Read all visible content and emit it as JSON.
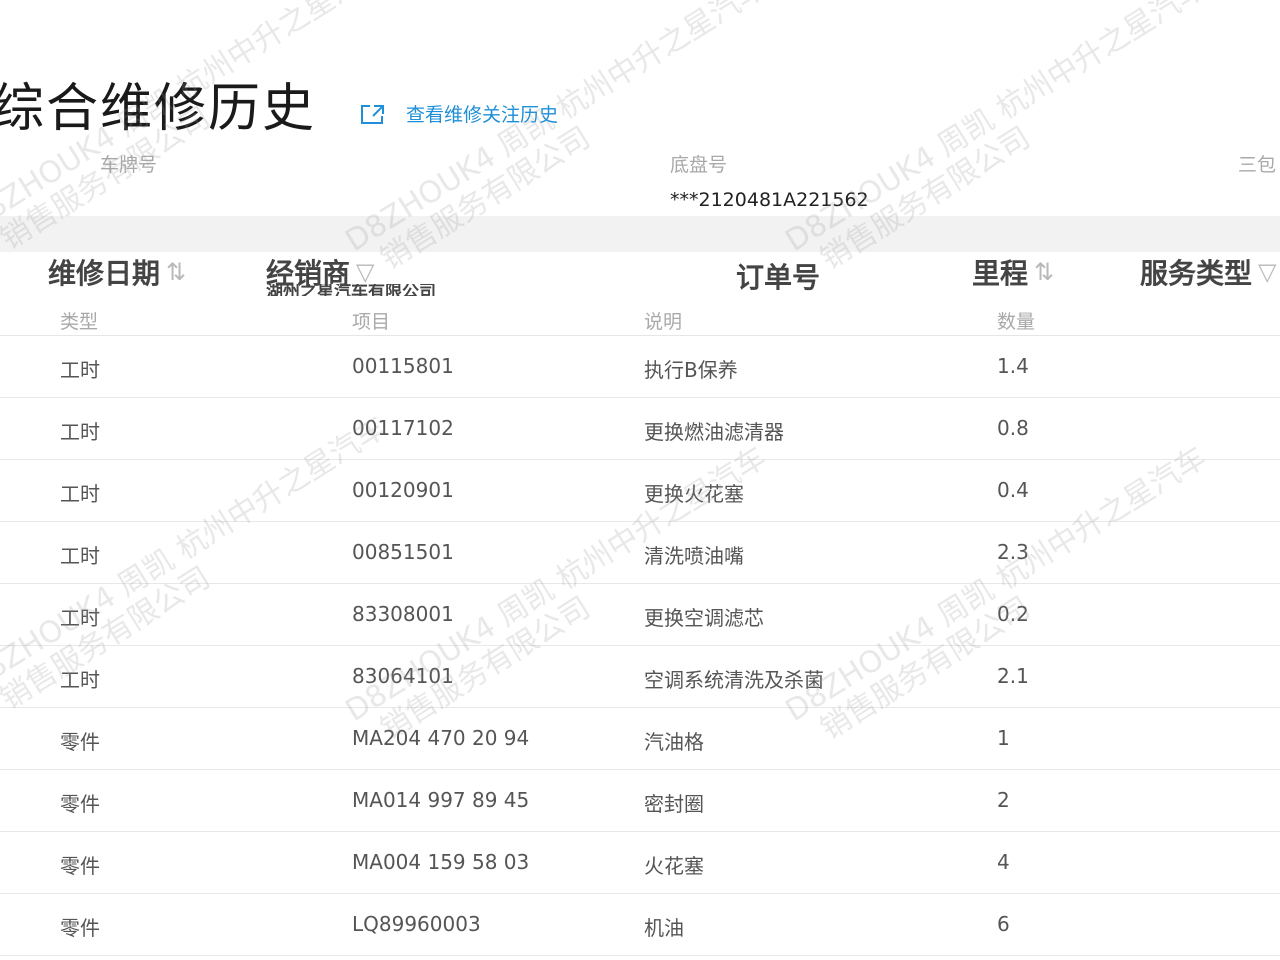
{
  "page": {
    "title": "综合维修历史"
  },
  "history_link": {
    "label": "查看维修关注历史",
    "icon": "external-link-icon"
  },
  "info": {
    "plate_label": "车牌号",
    "chassis_label": "底盘号",
    "chassis_value": "***2120481A221562",
    "warranty_label": "三包"
  },
  "columns": {
    "repair_date": "维修日期",
    "dealer": "经销商",
    "dealer_value": "湖州之星汽车有限公司",
    "order_no": "订单号",
    "mileage": "里程",
    "service_type": "服务类型"
  },
  "sub_columns": {
    "type": "类型",
    "item": "项目",
    "desc": "说明",
    "qty": "数量"
  },
  "rows": [
    {
      "type": "工时",
      "item": "00115801",
      "desc": "执行B保养",
      "qty": "1.4"
    },
    {
      "type": "工时",
      "item": "00117102",
      "desc": "更换燃油滤清器",
      "qty": "0.8"
    },
    {
      "type": "工时",
      "item": "00120901",
      "desc": "更换火花塞",
      "qty": "0.4"
    },
    {
      "type": "工时",
      "item": "00851501",
      "desc": "清洗喷油嘴",
      "qty": "2.3"
    },
    {
      "type": "工时",
      "item": "83308001",
      "desc": "更换空调滤芯",
      "qty": "0.2"
    },
    {
      "type": "工时",
      "item": "83064101",
      "desc": "空调系统清洗及杀菌",
      "qty": "2.1"
    },
    {
      "type": "零件",
      "item": "MA204 470 20 94",
      "desc": "汽油格",
      "qty": "1"
    },
    {
      "type": "零件",
      "item": "MA014 997 89 45",
      "desc": "密封圈",
      "qty": "2"
    },
    {
      "type": "零件",
      "item": "MA004 159 58 03",
      "desc": "火花塞",
      "qty": "4"
    },
    {
      "type": "零件",
      "item": "LQ89960003",
      "desc": "机油",
      "qty": "6"
    }
  ],
  "watermark": {
    "line1": "D8ZHOUK4 周凯 杭州中升之星汽车",
    "line2": "销售服务有限公司"
  }
}
